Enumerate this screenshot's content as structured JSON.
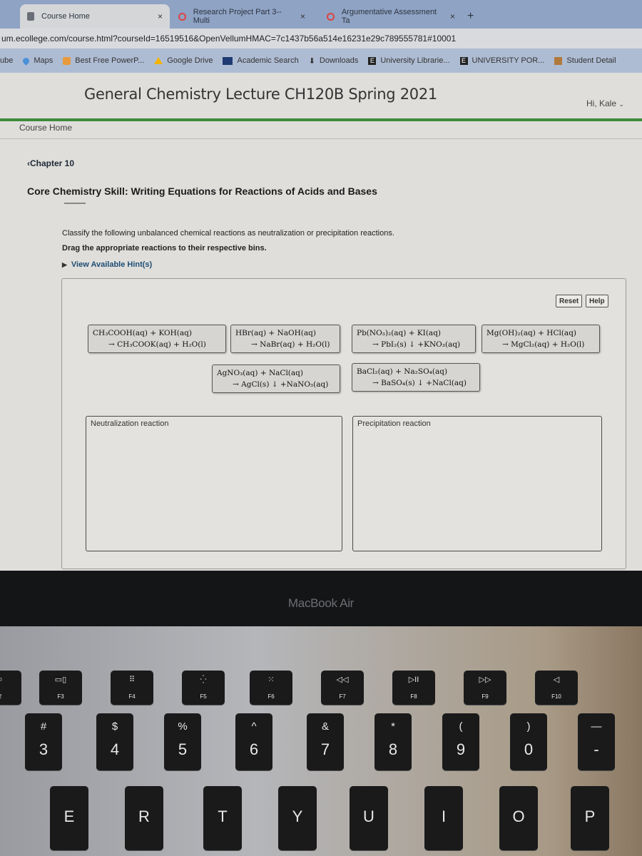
{
  "browser": {
    "tabs": [
      {
        "label": "Course Home",
        "active": true,
        "icon": "page-icon"
      },
      {
        "label": "Research Project Part 3--Multi",
        "active": false,
        "icon": "pearson-icon"
      },
      {
        "label": "Argumentative Assessment Ta",
        "active": false,
        "icon": "pearson-icon"
      }
    ],
    "new_tab": "+",
    "close_glyph": "×",
    "url": "um.ecollege.com/course.html?courseId=16519516&OpenVellumHMAC=7c1437b56a514e16231e29c789555781#10001",
    "bookmarks": [
      {
        "label": "ube",
        "icon": "youtube-icon",
        "color": "#c33"
      },
      {
        "label": "Maps",
        "icon": "maps-pin-icon",
        "color": "#4a90d9"
      },
      {
        "label": "Best Free PowerP...",
        "icon": "powerpoint-icon",
        "color": "#e89a3c"
      },
      {
        "label": "Google Drive",
        "icon": "google-drive-icon",
        "color": "#f4b400"
      },
      {
        "label": "Academic Search",
        "icon": "ebsco-icon",
        "color": "#1f3b73"
      },
      {
        "label": "Downloads",
        "icon": "download-icon",
        "color": "#333333"
      },
      {
        "label": "University Librarie...",
        "icon": "university-e-icon",
        "color": "#222222"
      },
      {
        "label": "UNIVERSITY POR...",
        "icon": "university-e-icon",
        "color": "#222222"
      },
      {
        "label": "Student Detail",
        "icon": "student-icon",
        "color": "#b07a3c"
      }
    ]
  },
  "header": {
    "course_title": "General Chemistry Lecture CH120B Spring 2021",
    "greeting": "Hi, Kale",
    "greeting_caret": "⌄",
    "accent_color": "#3f8a3c"
  },
  "nav": {
    "course_home": "Course Home",
    "chapter_link": "‹Chapter 10"
  },
  "activity": {
    "title": "Core Chemistry Skill: Writing Equations for Reactions of Acids and Bases",
    "instructions": "Classify the following unbalanced chemical reactions as neutralization or precipitation reactions.",
    "drag_instructions": "Drag the appropriate reactions to their respective bins.",
    "hint_caret": "▶",
    "hint_label": "View Available Hint(s)"
  },
  "dnd": {
    "reset_label": "Reset",
    "help_label": "Help",
    "items": [
      {
        "line1": "CH₃COOH(aq) + KOH(aq)",
        "line2": "→ CH₃COOK(aq) + H₂O(l)"
      },
      {
        "line1": "HBr(aq) + NaOH(aq)",
        "line2": "→ NaBr(aq) + H₂O(l)"
      },
      {
        "line1": "Pb(NO₃)₂(aq) + KI(aq)",
        "line2": "→ PbI₂(s) ↓ +KNO₃(aq)"
      },
      {
        "line1": "Mg(OH)₂(aq) + HCl(aq)",
        "line2": "→ MgCl₂(aq) + H₂O(l)"
      },
      {
        "line1": "AgNO₃(aq) + NaCl(aq)",
        "line2": "→ AgCl(s) ↓ +NaNO₃(aq)"
      },
      {
        "line1": "BaCl₂(aq) + Na₂SO₄(aq)",
        "line2": "→ BaSO₄(s) ↓ +NaCl(aq)"
      }
    ],
    "bins": [
      {
        "label": "Neutralization reaction"
      },
      {
        "label": "Precipitation reaction"
      }
    ]
  },
  "laptop": {
    "model_label": "MacBook Air",
    "function_keys": [
      {
        "glyph": "☼",
        "label": "2"
      },
      {
        "glyph": "▭▯",
        "label": "F3"
      },
      {
        "glyph": "⠿",
        "label": "F4"
      },
      {
        "glyph": "⁛",
        "label": "F5"
      },
      {
        "glyph": "⁙",
        "label": "F6"
      },
      {
        "glyph": "◁◁",
        "label": "F7"
      },
      {
        "glyph": "▷II",
        "label": "F8"
      },
      {
        "glyph": "▷▷",
        "label": "F9"
      },
      {
        "glyph": "◁",
        "label": "F10"
      }
    ],
    "number_keys": [
      {
        "sym": "#",
        "num": "3"
      },
      {
        "sym": "$",
        "num": "4"
      },
      {
        "sym": "%",
        "num": "5"
      },
      {
        "sym": "^",
        "num": "6"
      },
      {
        "sym": "&",
        "num": "7"
      },
      {
        "sym": "*",
        "num": "8"
      },
      {
        "sym": "(",
        "num": "9"
      },
      {
        "sym": ")",
        "num": "0"
      },
      {
        "sym": "—",
        "num": "-"
      }
    ],
    "letter_keys": [
      "E",
      "R",
      "T",
      "Y",
      "U",
      "I",
      "O",
      "P"
    ]
  }
}
